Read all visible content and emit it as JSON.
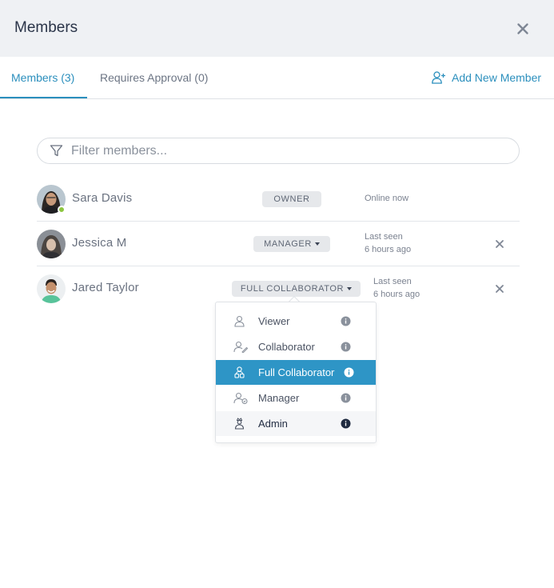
{
  "header": {
    "title": "Members"
  },
  "tabs": [
    {
      "label": "Members (3)",
      "active": true
    },
    {
      "label": "Requires Approval (0)",
      "active": false
    }
  ],
  "add_member_label": "Add New Member",
  "filter": {
    "placeholder": "Filter members...",
    "value": ""
  },
  "members": [
    {
      "name": "Sara Davis",
      "role": "OWNER",
      "status_line1": "Online now",
      "status_line2": "",
      "online": true
    },
    {
      "name": "Jessica M",
      "role": "MANAGER",
      "status_line1": "Last seen",
      "status_line2": "6 hours ago",
      "online": false
    },
    {
      "name": "Jared Taylor",
      "role": "FULL COLLABORATOR",
      "status_line1": "Last seen",
      "status_line2": "6 hours ago",
      "online": false
    }
  ],
  "role_menu": {
    "items": [
      {
        "label": "Viewer",
        "icon": "viewer-icon"
      },
      {
        "label": "Collaborator",
        "icon": "collaborator-icon"
      },
      {
        "label": "Full Collaborator",
        "icon": "full-collaborator-icon",
        "selected": true
      },
      {
        "label": "Manager",
        "icon": "manager-icon"
      },
      {
        "label": "Admin",
        "icon": "admin-icon",
        "hovered": true
      }
    ]
  },
  "colors": {
    "accent": "#2b8fbd",
    "selected_bg": "#2e95c6",
    "online": "#8cc63f",
    "header_bg": "#eff1f4"
  }
}
